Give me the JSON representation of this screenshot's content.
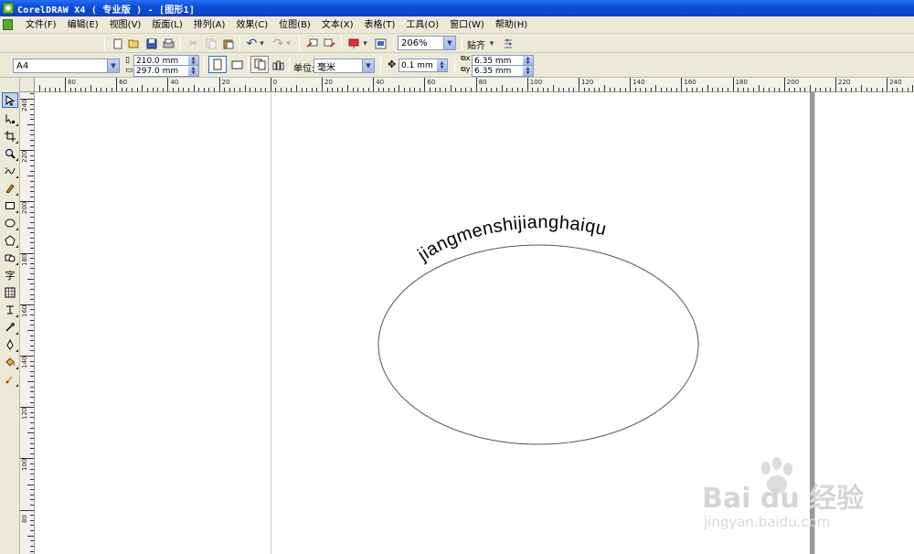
{
  "window": {
    "title": "CorelDRAW X4 ( 专业版 ) - [图形1]"
  },
  "menu": [
    "文件(F)",
    "编辑(E)",
    "视图(V)",
    "版面(L)",
    "排列(A)",
    "效果(C)",
    "位图(B)",
    "文本(X)",
    "表格(T)",
    "工具(O)",
    "窗口(W)",
    "帮助(H)"
  ],
  "toolbar": {
    "zoom": "206%",
    "snap_label": "贴齐"
  },
  "property_bar": {
    "paper_size": "A4",
    "width": "210.0 mm",
    "height": "297.0 mm",
    "units_label": "单位:",
    "units_value": "毫米",
    "nudge": "0.1 mm",
    "dup_x": "6.35 mm",
    "dup_y": "6.35 mm"
  },
  "rulers": {
    "horizontal": [
      "80",
      "60",
      "40",
      "20",
      "0",
      "20",
      "40",
      "60",
      "80",
      "100",
      "120",
      "140",
      "160",
      "180",
      "200",
      "220",
      "240"
    ],
    "vertical": [
      "240",
      "220",
      "200",
      "180",
      "160",
      "140",
      "120",
      "100",
      "80"
    ]
  },
  "canvas": {
    "text_on_path": "jiangmenshijianghaiqu"
  },
  "watermark": {
    "main": "Bai du 经验",
    "sub": "jingyan.baidu.com"
  },
  "colors": {
    "titlebar": "#0a4fd8",
    "chrome": "#ece9d8",
    "canvas": "#ffffff"
  }
}
